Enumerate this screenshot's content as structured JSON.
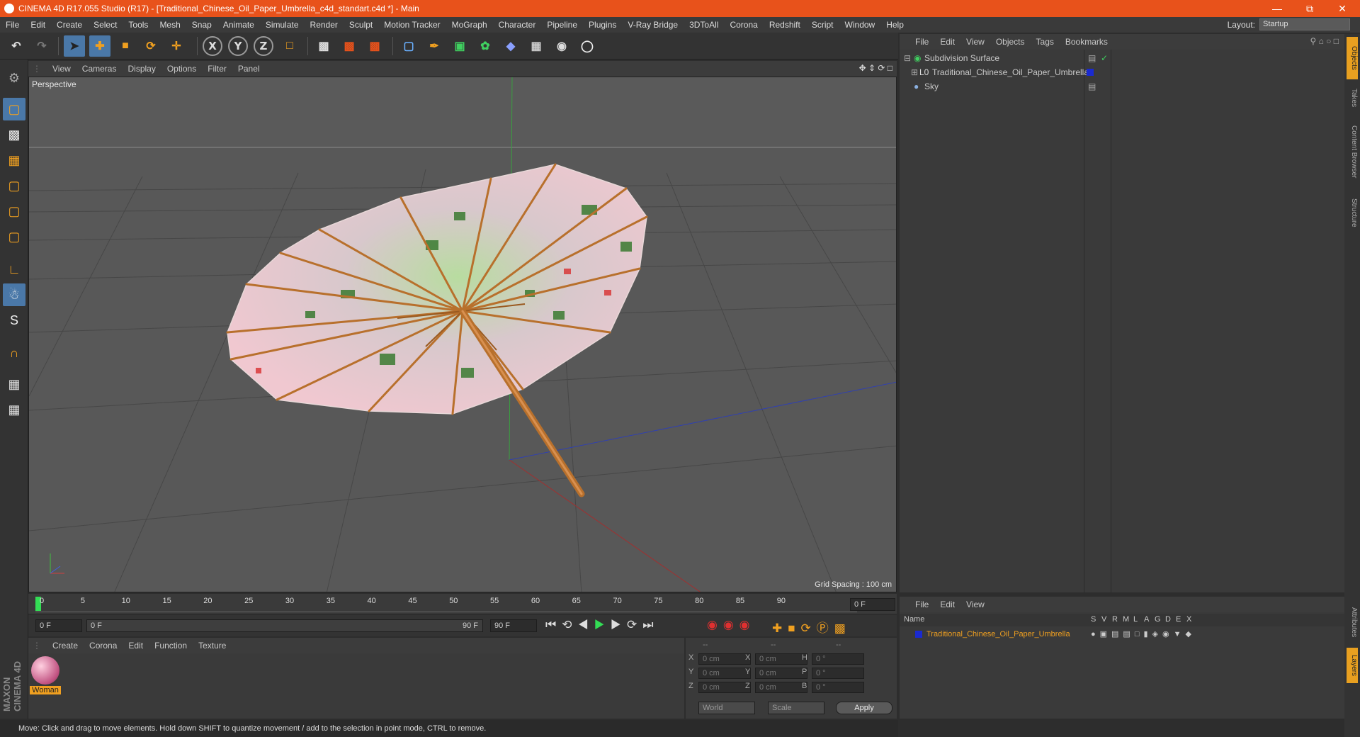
{
  "window": {
    "title": "CINEMA 4D R17.055 Studio (R17) - [Traditional_Chinese_Oil_Paper_Umbrella_c4d_standart.c4d *] - Main"
  },
  "menu": [
    "File",
    "Edit",
    "Create",
    "Select",
    "Tools",
    "Mesh",
    "Snap",
    "Animate",
    "Simulate",
    "Render",
    "Sculpt",
    "Motion Tracker",
    "MoGraph",
    "Character",
    "Pipeline",
    "Plugins",
    "V-Ray Bridge",
    "3DToAll",
    "Corona",
    "Redshift",
    "Script",
    "Window",
    "Help"
  ],
  "layout": {
    "label": "Layout:",
    "value": "Startup"
  },
  "viewport": {
    "menu": [
      "View",
      "Cameras",
      "Display",
      "Options",
      "Filter",
      "Panel"
    ],
    "label": "Perspective",
    "grid_spacing": "Grid Spacing : 100 cm"
  },
  "timeline": {
    "ticks": [
      "0",
      "5",
      "10",
      "15",
      "20",
      "25",
      "30",
      "35",
      "40",
      "45",
      "50",
      "55",
      "60",
      "65",
      "70",
      "75",
      "80",
      "85",
      "90"
    ],
    "frame_field": "0 F",
    "start": "0 F",
    "range_start": "0 F",
    "range_end": "90 F",
    "end": "90 F"
  },
  "material": {
    "menu": [
      "Create",
      "Corona",
      "Edit",
      "Function",
      "Texture"
    ],
    "name": "Woman"
  },
  "coords": {
    "header": [
      "--",
      "--",
      "--"
    ],
    "rows": [
      [
        "X",
        "0 cm",
        "X",
        "0 cm",
        "H",
        "0 °"
      ],
      [
        "Y",
        "0 cm",
        "Y",
        "0 cm",
        "P",
        "0 °"
      ],
      [
        "Z",
        "0 cm",
        "Z",
        "0 cm",
        "B",
        "0 °"
      ]
    ],
    "world": "World",
    "scale": "Scale",
    "apply": "Apply"
  },
  "objects": {
    "menu": [
      "File",
      "Edit",
      "View",
      "Objects",
      "Tags",
      "Bookmarks"
    ],
    "items": [
      "Subdivision Surface",
      "Traditional_Chinese_Oil_Paper_Umbrella",
      "Sky"
    ]
  },
  "layers": {
    "menu": [
      "File",
      "Edit",
      "View"
    ],
    "cols": [
      "Name",
      "S",
      "V",
      "R",
      "M",
      "L",
      "A",
      "G",
      "D",
      "E",
      "X"
    ],
    "row": "Traditional_Chinese_Oil_Paper_Umbrella"
  },
  "status": "Move: Click and drag to move elements. Hold down SHIFT to quantize movement / add to the selection in point mode, CTRL to remove.",
  "side_tabs": [
    "Objects",
    "Takes",
    "Content Browser",
    "Structure",
    "Attributes",
    "Layers"
  ],
  "brand": "MAXON CINEMA 4D"
}
